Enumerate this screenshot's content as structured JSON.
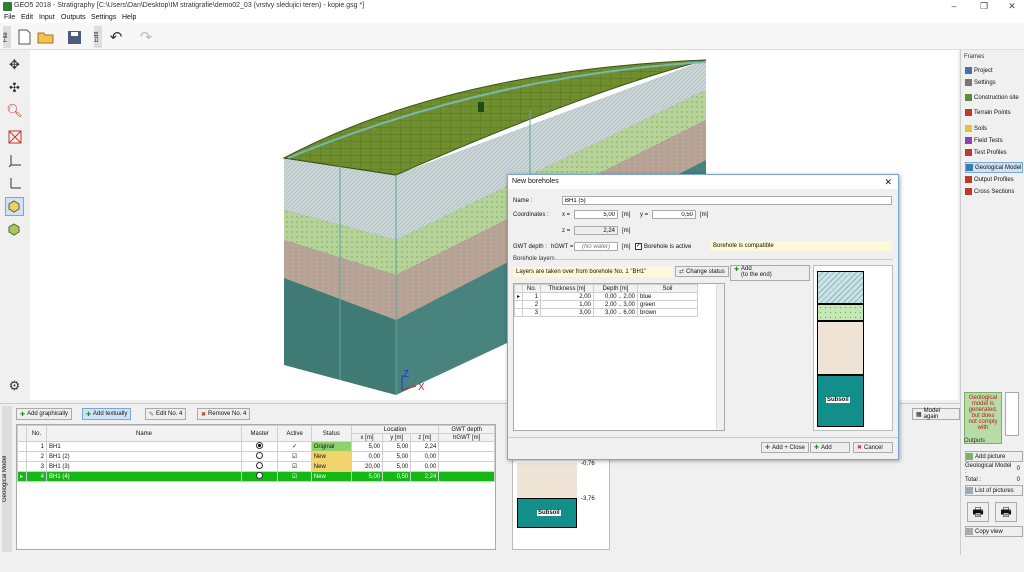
{
  "app": {
    "title": "GEO5 2018 - Stratigraphy [C:\\Users\\Dan\\Desktop\\IM stratigrafie\\demo02_03 (vrstvy sledujici teren) - kopie.gsg *]"
  },
  "menu": [
    "File",
    "Edit",
    "Input",
    "Outputs",
    "Settings",
    "Help"
  ],
  "toolbar": {
    "file_tab": "File",
    "edit_tab": "Edit"
  },
  "right_panel": {
    "frames_header": "Frames",
    "items": [
      {
        "label": "Project",
        "icon": "project-icon",
        "color": "#4a6fa5"
      },
      {
        "label": "Settings",
        "icon": "settings-icon",
        "color": "#777777"
      },
      {
        "label": "Construction site",
        "icon": "construction-site-icon",
        "color": "#5b8c3a"
      },
      {
        "label": "Terrain Points",
        "icon": "terrain-points-icon",
        "color": "#c0392b"
      },
      {
        "label": "Soils",
        "icon": "soils-icon",
        "color": "#e1c340"
      },
      {
        "label": "Field Tests",
        "icon": "field-tests-icon",
        "color": "#8e44ad"
      },
      {
        "label": "Test Profiles",
        "icon": "test-profiles-icon",
        "color": "#c0392b"
      },
      {
        "label": "Geological Model",
        "icon": "geological-model-icon",
        "color": "#3a7ab5"
      },
      {
        "label": "Output Profiles",
        "icon": "output-profiles-icon",
        "color": "#c0392b"
      },
      {
        "label": "Cross Sections",
        "icon": "cross-sections-icon",
        "color": "#c0392b"
      }
    ],
    "warning": "Geological model is generated, but does not comply with",
    "outputs_header": "Outputs",
    "add_picture": "Add picture",
    "geo_model_label": "Geological Model :",
    "geo_model_count": "0",
    "total_label": "Total :",
    "total_count": "0",
    "list_of_pictures": "List of pictures",
    "copy_view": "Copy view"
  },
  "bottom": {
    "side_label": "Geological Model",
    "buttons": [
      "Add graphically",
      "Add textually",
      "Edit No. 4",
      "Remove No. 4"
    ],
    "model_again": "Model again",
    "headers": {
      "no": "No.",
      "name": "Name",
      "master": "Master",
      "active": "Active",
      "status": "Status",
      "location": "Location",
      "x": "x [m]",
      "y": "y [m]",
      "z": "z [m]",
      "gwt": "GWT depth",
      "hgwt": "hGWT [m]"
    },
    "rows": [
      {
        "no": "1",
        "name": "BH1",
        "master": true,
        "active": "✓",
        "status": "Original",
        "x": "5,00",
        "y": "5,00",
        "z": "2,24",
        "gwt": ""
      },
      {
        "no": "2",
        "name": "BH1 (2)",
        "master": false,
        "active": "☑",
        "status": "New",
        "x": "0,00",
        "y": "5,00",
        "z": "0,00",
        "gwt": ""
      },
      {
        "no": "3",
        "name": "BH1 (3)",
        "master": false,
        "active": "☑",
        "status": "New",
        "x": "20,00",
        "y": "5,00",
        "z": "0,00",
        "gwt": ""
      },
      {
        "no": "4",
        "name": "BH1 (4)",
        "master": false,
        "active": "☑",
        "status": "New",
        "x": "5,00",
        "y": "0,50",
        "z": "2,24",
        "gwt": ""
      }
    ],
    "preview_depths": [
      "-0,76",
      "-3,76"
    ],
    "preview_subsoil": "Subsoil"
  },
  "dialog": {
    "title": "New boreholes",
    "name_label": "Name :",
    "name_value": "BH1 (5)",
    "coords_label": "Coordinates :",
    "x_label": "x =",
    "x_value": "5,00",
    "x_unit": "[m]",
    "y_label": "y =",
    "y_value": "0,50",
    "y_unit": "[m]",
    "z_label": "z =",
    "z_value": "2,24",
    "z_unit": "[m]",
    "gwt_label": "GWT depth :",
    "hgwt_label": "hGWT =",
    "gwt_placeholder": "(No water)",
    "gwt_unit": "[m]",
    "active_label": "Borehole is active",
    "compatible_note": "Borehole is compatible",
    "layers_header": "Borehole layers",
    "layers_note": "Layers are taken over from borehole No. 1 \"BH1\"",
    "change_status": "Change status",
    "add_end": "Add",
    "add_end_sub": "(to the end)",
    "table_headers": [
      "No.",
      "Thickness [m]",
      "Depth [m]",
      "Soil"
    ],
    "layers": [
      {
        "no": "1",
        "thickness": "2,00",
        "depth": "0,00 .. 2,00",
        "soil": "blue"
      },
      {
        "no": "2",
        "thickness": "1,00",
        "depth": "2,00 .. 3,00",
        "soil": "green"
      },
      {
        "no": "3",
        "thickness": "3,00",
        "depth": "3,00 .. 6,00",
        "soil": "brown"
      }
    ],
    "subsoil": "Subsoil",
    "add_close": "Add + Close",
    "add": "Add",
    "cancel": "Cancel"
  },
  "viewport": {
    "axis_z": "Z",
    "axis_x": "X"
  }
}
